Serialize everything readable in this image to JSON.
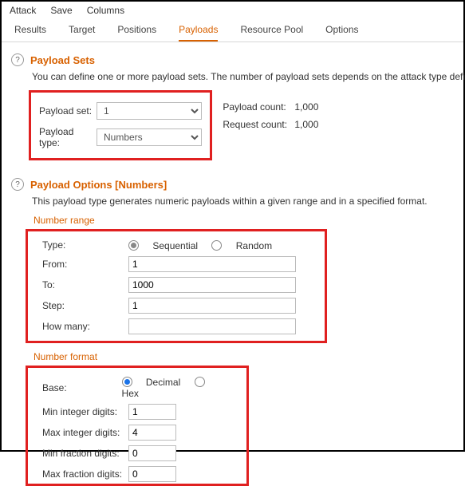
{
  "menu": {
    "attack": "Attack",
    "save": "Save",
    "columns": "Columns"
  },
  "tabs": {
    "results": "Results",
    "target": "Target",
    "positions": "Positions",
    "payloads": "Payloads",
    "resource_pool": "Resource Pool",
    "options": "Options"
  },
  "payload_sets": {
    "title": "Payload Sets",
    "desc": "You can define one or more payload sets. The number of payload sets depends on the attack type defined in the P",
    "set_label": "Payload set:",
    "set_value": "1",
    "type_label": "Payload type:",
    "type_value": "Numbers",
    "count_label": "Payload count:",
    "count_value": "1,000",
    "request_label": "Request count:",
    "request_value": "1,000"
  },
  "payload_options": {
    "title": "Payload Options [Numbers]",
    "desc": "This payload type generates numeric payloads within a given range and in a specified format.",
    "number_range": {
      "heading": "Number range",
      "type_label": "Type:",
      "sequential": "Sequential",
      "random": "Random",
      "from_label": "From:",
      "from_value": "1",
      "to_label": "To:",
      "to_value": "1000",
      "step_label": "Step:",
      "step_value": "1",
      "howmany_label": "How many:",
      "howmany_value": ""
    },
    "number_format": {
      "heading": "Number format",
      "base_label": "Base:",
      "decimal": "Decimal",
      "hex": "Hex",
      "min_int_label": "Min integer digits:",
      "min_int_value": "1",
      "max_int_label": "Max integer digits:",
      "max_int_value": "4",
      "min_frac_label": "Min fraction digits:",
      "min_frac_value": "0",
      "max_frac_label": "Max fraction digits:",
      "max_frac_value": "0"
    }
  }
}
